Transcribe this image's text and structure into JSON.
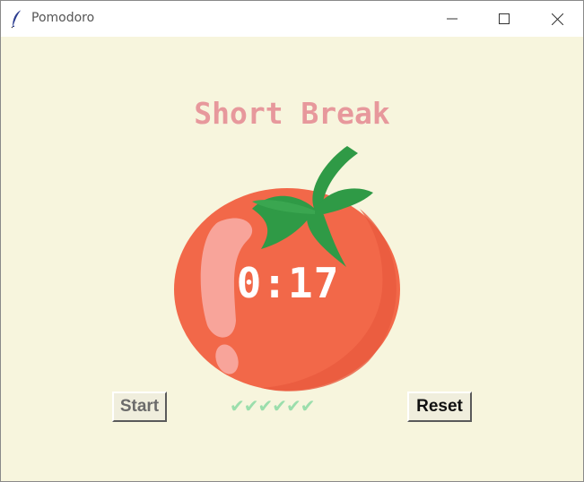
{
  "window": {
    "title": "Pomodoro",
    "icon": "feather-icon"
  },
  "title_controls": {
    "minimize": "minimize-icon",
    "maximize": "maximize-icon",
    "close": "close-icon"
  },
  "main": {
    "heading": "Short Break",
    "heading_color": "#e7989c",
    "timer": "0:17",
    "tomato_color": "#f26849",
    "checkmarks": "✔✔✔✔✔✔",
    "checkmark_color": "#9bdeac",
    "background_color": "#f7f5dd"
  },
  "buttons": {
    "start_label": "Start",
    "reset_label": "Reset"
  }
}
